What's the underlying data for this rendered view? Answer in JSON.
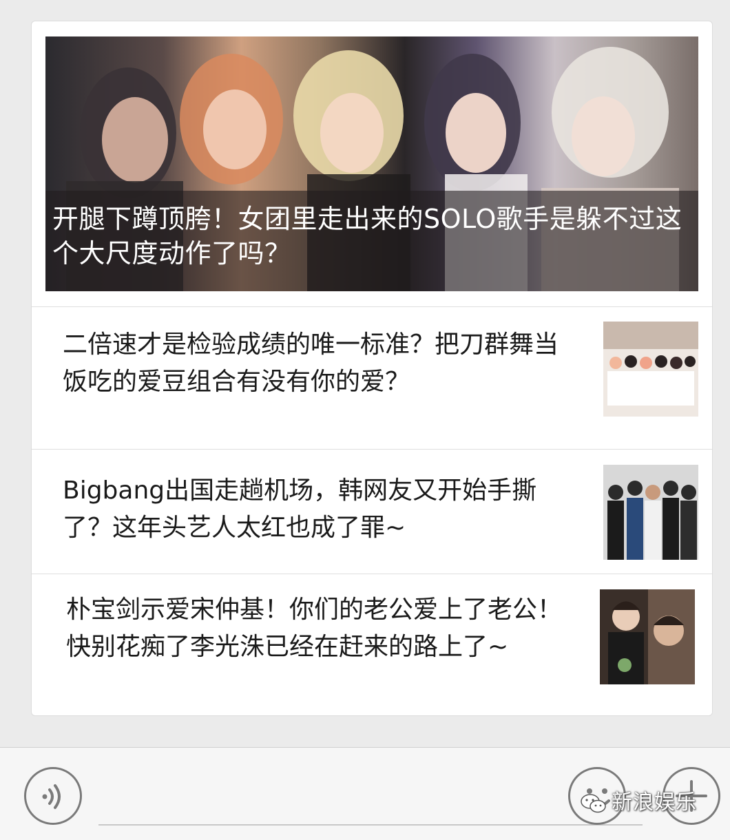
{
  "articles": {
    "featured": {
      "title": "开腿下蹲顶胯！女团里走出来的SOLO歌手是躲不过这个大尺度动作了吗？"
    },
    "items": [
      {
        "title": "二倍速才是检验成绩的唯一标准？把刀群舞当饭吃的爱豆组合有没有你的爱？"
      },
      {
        "title": "Bigbang出国走趟机场，韩网友又开始手撕了？这年头艺人太红也成了罪~"
      },
      {
        "title": "朴宝剑示爱宋仲基！你们的老公爱上了老公！快别花痴了李光洙已经在赶来的路上了~"
      }
    ]
  },
  "input_bar": {
    "voice_icon": "voice-icon",
    "emoji_icon": "emoji-icon",
    "plus_icon": "plus-icon"
  },
  "watermark": {
    "text": "新浪娱乐"
  }
}
